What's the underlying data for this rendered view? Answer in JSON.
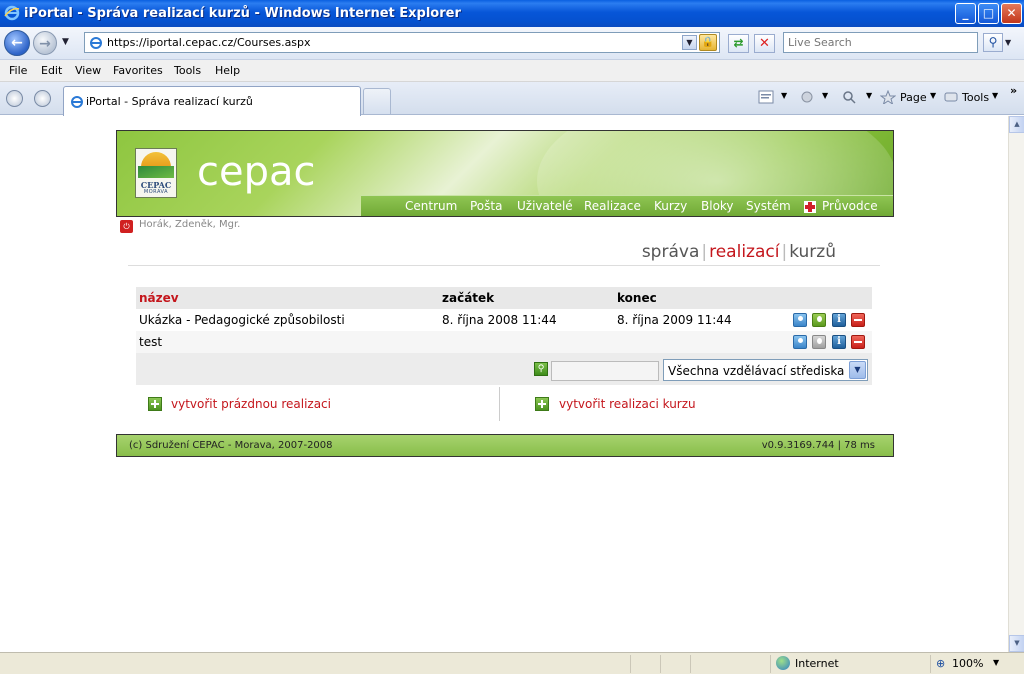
{
  "window": {
    "title": "iPortal - Správa realizací kurzů - Windows Internet Explorer",
    "buttons": {
      "minimize": "_",
      "maximize": "□",
      "close": "✕"
    }
  },
  "addressbar": {
    "url": "https://iportal.cepac.cz/Courses.aspx",
    "search_placeholder": "Live Search"
  },
  "menubar": {
    "items": [
      "File",
      "Edit",
      "View",
      "Favorites",
      "Tools",
      "Help"
    ]
  },
  "tabbar": {
    "active_tab": "iPortal - Správa realizací kurzů",
    "commands": {
      "page": "Page",
      "tools": "Tools",
      "more": "»"
    }
  },
  "site": {
    "brand": "cepac",
    "logo": {
      "line1": "CEPAC",
      "line2": "MORAVA"
    },
    "nav": [
      "Centrum",
      "Pošta",
      "Uživatelé",
      "Realizace",
      "Kurzy",
      "Bloky",
      "Systém",
      "Průvodce"
    ],
    "user": "Horák, Zdeněk, Mgr.",
    "heading": {
      "part1": "správa",
      "part2": "realizací",
      "part3": "kurzů"
    }
  },
  "table": {
    "columns": {
      "name": "název",
      "start": "začátek",
      "end": "konec"
    },
    "rows": [
      {
        "name": "Ukázka - Pedagogické způsobilosti",
        "start": "8. října 2008 11:44",
        "end": "8. října 2009 11:44"
      },
      {
        "name": "test",
        "start": "",
        "end": ""
      }
    ],
    "filter": {
      "center_select": "Všechna vzdělávací střediska"
    }
  },
  "actions": {
    "create_empty": "vytvořit prázdnou realizaci",
    "create_course": "vytvořit realizaci kurzu"
  },
  "footer": {
    "copyright": "(c) Sdružení CEPAC - Morava, 2007-2008",
    "version": "v0.9.3169.744 | 78 ms"
  },
  "statusbar": {
    "zone": "Internet",
    "zoom": "100%"
  },
  "colors": {
    "accent_red": "#c4161c",
    "nav_green": "#7cb63e",
    "titlebar_blue": "#0756d8"
  }
}
